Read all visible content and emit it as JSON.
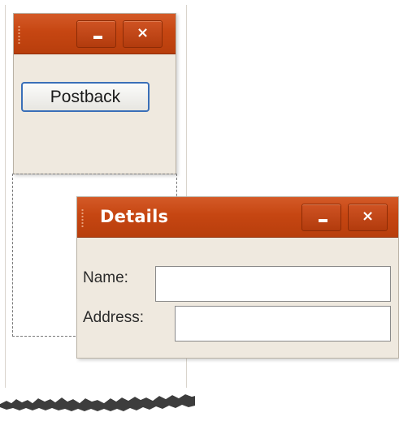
{
  "main_window": {
    "title": "",
    "minimize_glyph": "_",
    "close_glyph": "×",
    "postback_label": "Postback"
  },
  "details_window": {
    "title": "Details",
    "minimize_glyph": "_",
    "close_glyph": "×",
    "name_label": "Name:",
    "name_value": "",
    "address_label": "Address:",
    "address_value": ""
  },
  "colors": {
    "titlebar": "#c64612",
    "window_body": "#efe9df",
    "button_border": "#3a6fb8"
  }
}
